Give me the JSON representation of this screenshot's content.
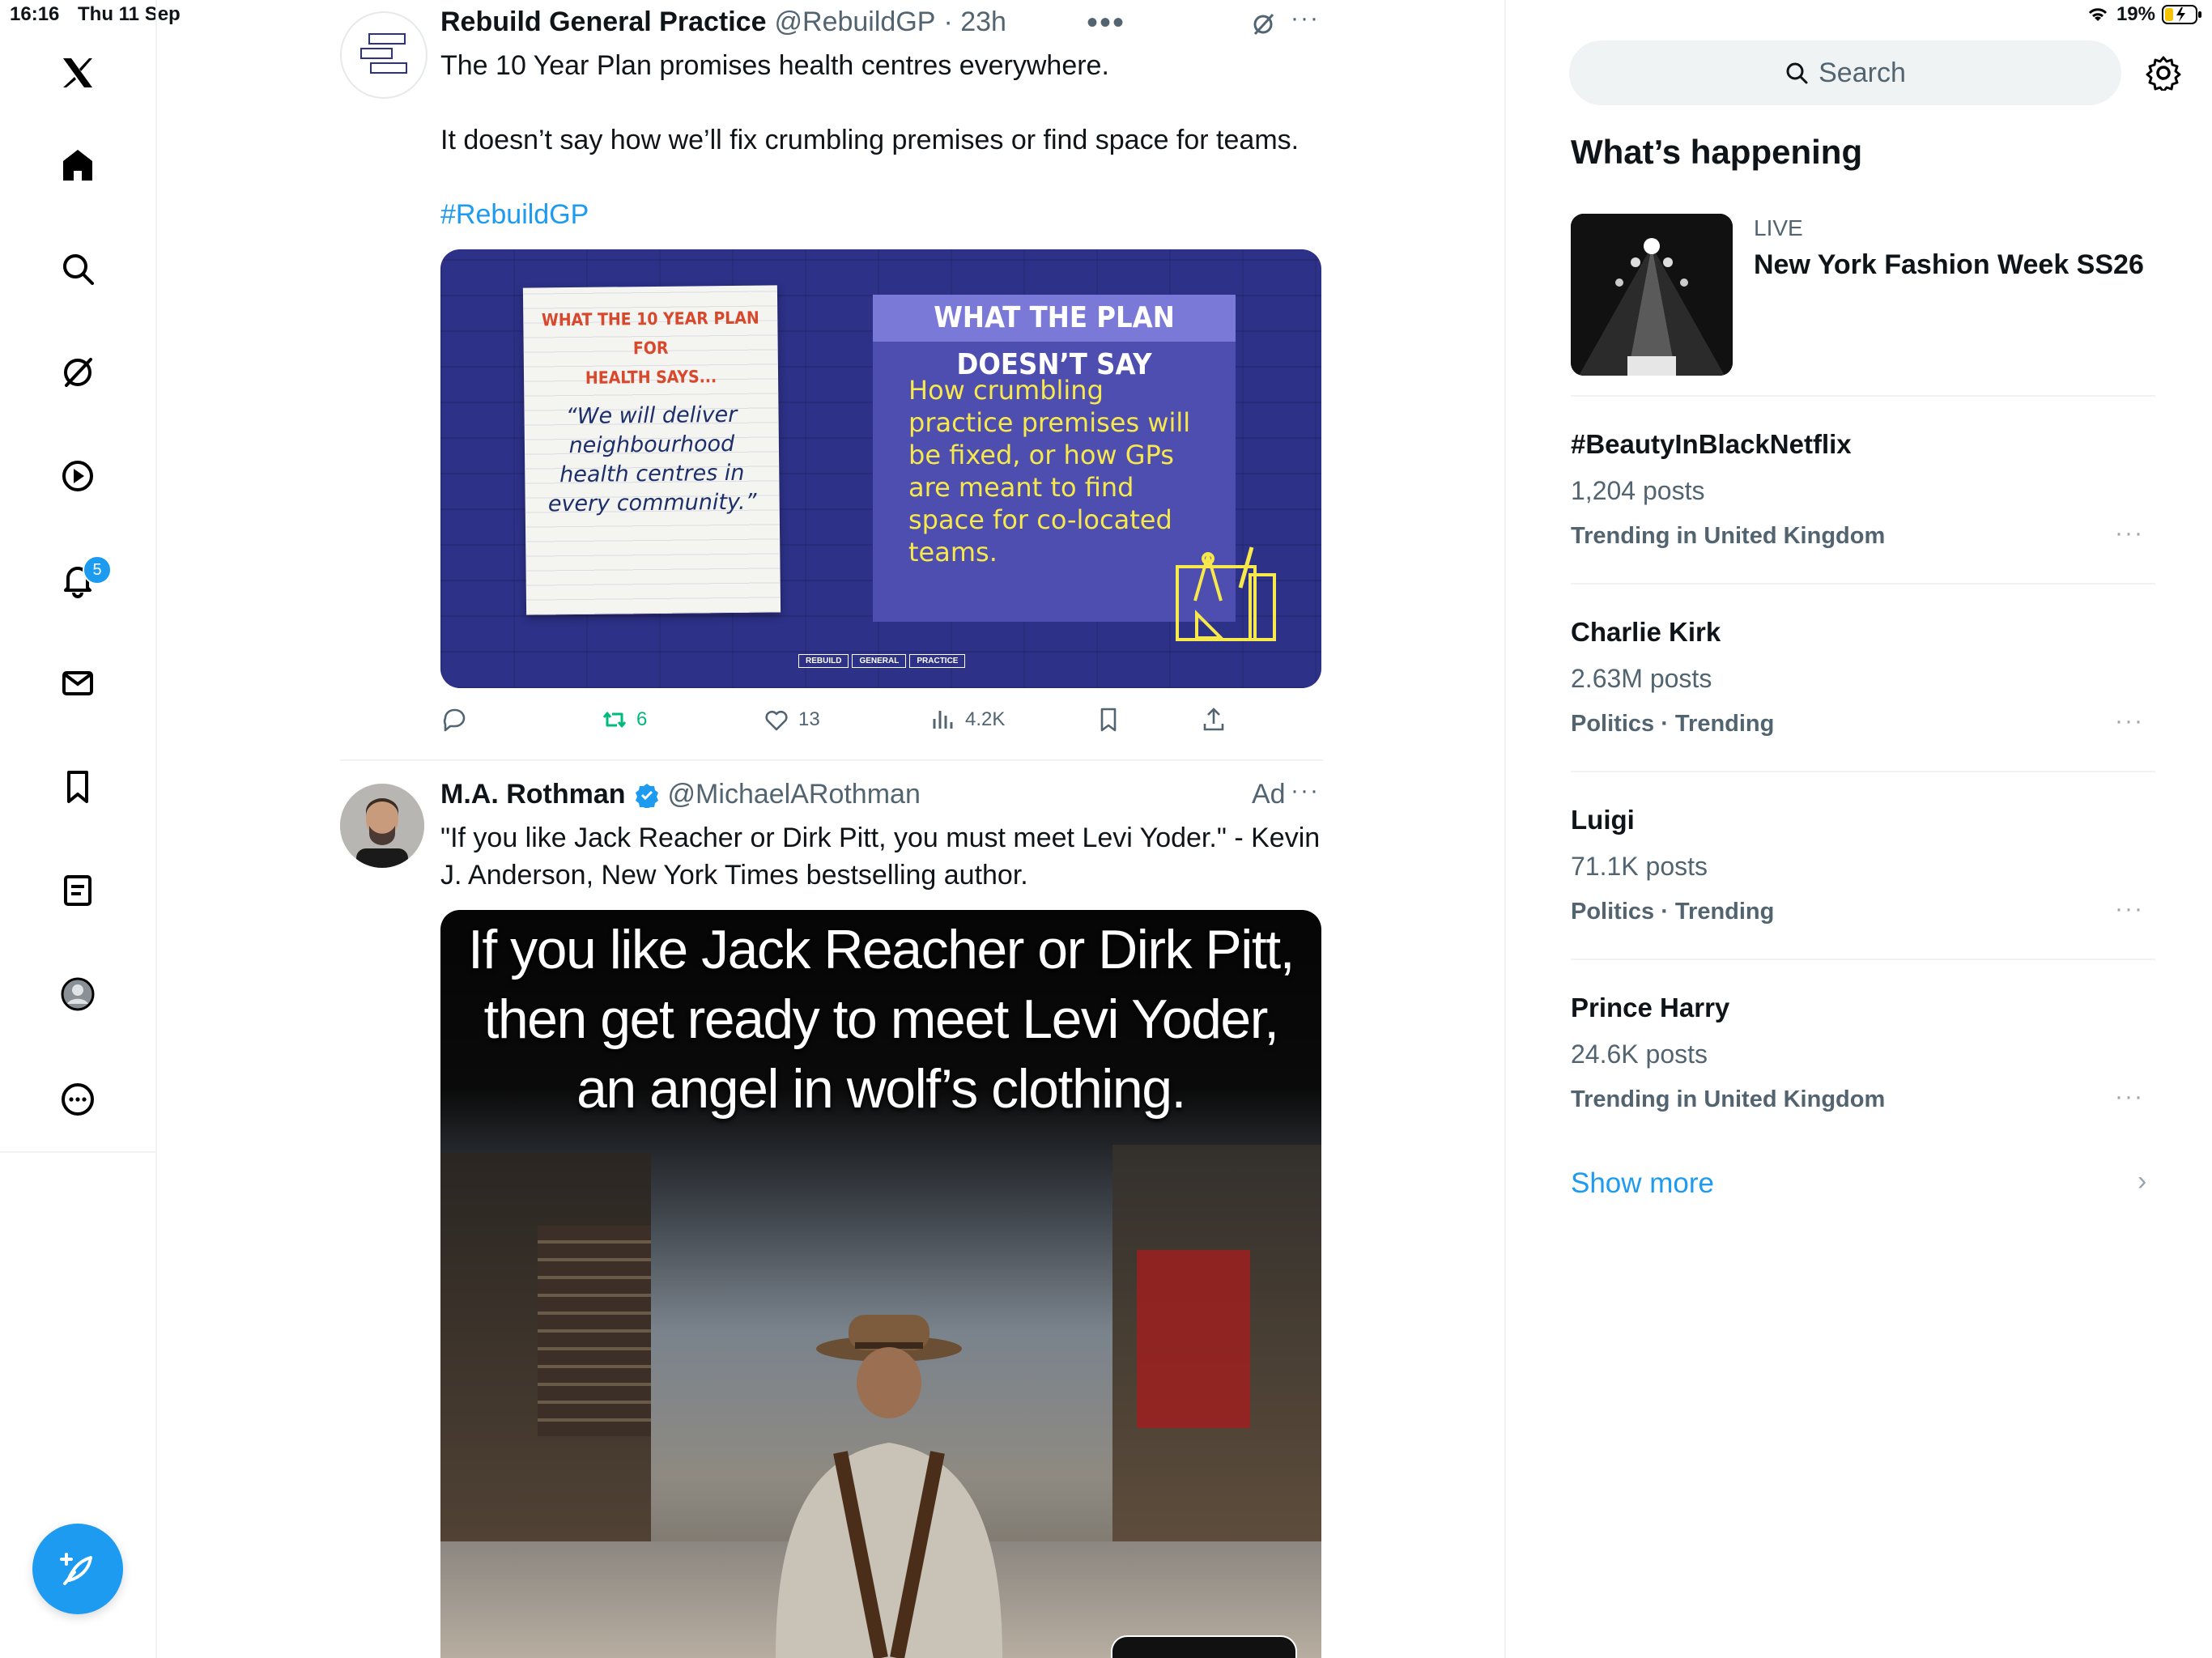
{
  "status_bar": {
    "time": "16:16",
    "date": "Thu 11 Sep",
    "battery": "19%"
  },
  "nav": {
    "notifications_badge": "5",
    "items": [
      "x-logo",
      "home",
      "search",
      "grok",
      "video",
      "notifications",
      "messages",
      "bookmarks",
      "lists",
      "profile",
      "more"
    ]
  },
  "tweet1": {
    "name": "Rebuild General Practice",
    "handle": "@RebuildGP",
    "time": "· 23h",
    "line1": "The 10 Year Plan promises health centres everywhere.",
    "line2": "It doesn’t say how we’ll fix crumbling premises or find space for teams.",
    "hashtag": "#RebuildGP",
    "image": {
      "note_title_1": "WHAT THE 10 YEAR PLAN FOR",
      "note_title_2": "HEALTH SAYS...",
      "note_quote": [
        "“We will deliver",
        "neighbourhood",
        "health centres in",
        "every community.”"
      ],
      "panel_title": "WHAT THE PLAN DOESN’T SAY",
      "panel_text": [
        "How crumbling",
        "practice premises will",
        "be fixed, or how GPs",
        "are meant to find",
        "space for co-located",
        "teams."
      ],
      "footer": [
        "REBUILD",
        "GENERAL",
        "PRACTICE"
      ]
    },
    "retweets": "6",
    "likes": "13",
    "views": "4.2K"
  },
  "tweet2": {
    "name": "M.A. Rothman",
    "handle": "@MichaelARothman",
    "ad_label": "Ad",
    "line1": "\"If you like Jack Reacher or Dirk Pitt, you must meet Levi Yoder.\" - Kevin",
    "line2": "J. Anderson, New York Times bestselling author.",
    "image_text": [
      "If you like Jack Reacher or Dirk Pitt,",
      "then get ready to meet Levi Yoder,",
      "an angel in wolf’s clothing."
    ]
  },
  "right": {
    "search_placeholder": "Search",
    "heading": "What’s happening",
    "live": {
      "label": "LIVE",
      "title": "New York Fashion Week SS26"
    },
    "trends": [
      {
        "name": "#BeautyInBlackNetflix",
        "count": "1,204 posts",
        "meta": "Trending in United Kingdom"
      },
      {
        "name": "Charlie Kirk",
        "count": "2.63M posts",
        "meta": "Politics · Trending"
      },
      {
        "name": "Luigi",
        "count": "71.1K posts",
        "meta": "Politics · Trending"
      },
      {
        "name": "Prince Harry",
        "count": "24.6K posts",
        "meta": "Trending in United Kingdom"
      }
    ],
    "show_more": "Show more"
  },
  "colors": {
    "accent": "#1d9bf0",
    "retweet_green": "#00ba7c",
    "image_bg": "#2d3187",
    "panel_yellow": "#f7e84b"
  }
}
